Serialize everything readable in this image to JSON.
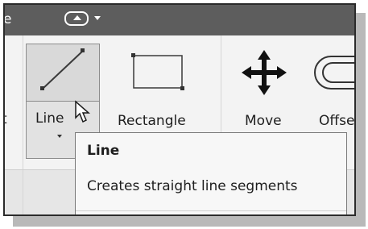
{
  "titlebar": {
    "edge_text": "e",
    "quick_access_icon": "eject-icon",
    "dropdown_icon": "caret-down-icon"
  },
  "ribbon": {
    "left_partial_label": "t",
    "tools": [
      {
        "label": "Line",
        "icon": "line-icon",
        "state": "hovered"
      },
      {
        "label": "Rectangle",
        "icon": "rectangle-icon"
      },
      {
        "label": "Move",
        "icon": "move-arrows-icon"
      },
      {
        "label": "Offse",
        "icon": "offset-icon"
      }
    ]
  },
  "tooltip": {
    "title": "Line",
    "description": "Creates straight line segments"
  },
  "colors": {
    "titlebar": "#5d5d5d",
    "ribbon": "#f3f3f3",
    "hover_button": "#d9d9d9",
    "tooltip": "#f7f7f7"
  }
}
